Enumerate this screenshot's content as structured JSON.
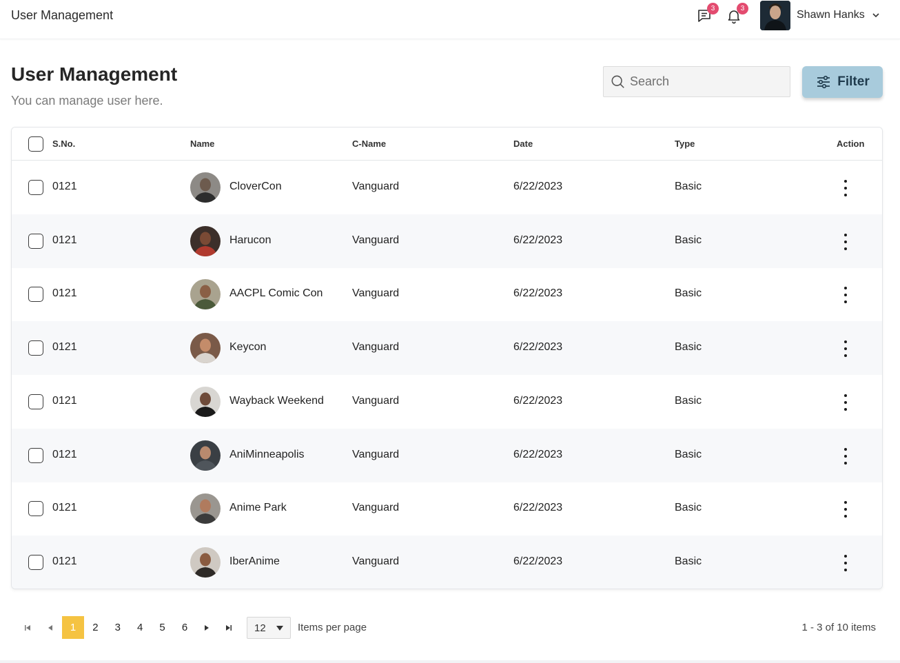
{
  "header": {
    "app_title": "User Management",
    "messages_badge": "3",
    "notifications_badge": "3",
    "user_name": "Shawn Hanks"
  },
  "page": {
    "title": "User Management",
    "subtitle": "You can manage user here."
  },
  "search": {
    "placeholder": "Search"
  },
  "filter": {
    "label": "Filter"
  },
  "table": {
    "columns": [
      "S.No.",
      "Name",
      "C-Name",
      "Date",
      "Type",
      "Action"
    ],
    "rows": [
      {
        "sno": "0121",
        "name": "CloverCon",
        "cname": "Vanguard",
        "date": "6/22/2023",
        "type": "Basic"
      },
      {
        "sno": "0121",
        "name": "Harucon",
        "cname": "Vanguard",
        "date": "6/22/2023",
        "type": "Basic"
      },
      {
        "sno": "0121",
        "name": "AACPL Comic Con",
        "cname": "Vanguard",
        "date": "6/22/2023",
        "type": "Basic"
      },
      {
        "sno": "0121",
        "name": "Keycon",
        "cname": "Vanguard",
        "date": "6/22/2023",
        "type": "Basic"
      },
      {
        "sno": "0121",
        "name": "Wayback Weekend",
        "cname": "Vanguard",
        "date": "6/22/2023",
        "type": "Basic"
      },
      {
        "sno": "0121",
        "name": "AniMinneapolis",
        "cname": "Vanguard",
        "date": "6/22/2023",
        "type": "Basic"
      },
      {
        "sno": "0121",
        "name": "Anime Park",
        "cname": "Vanguard",
        "date": "6/22/2023",
        "type": "Basic"
      },
      {
        "sno": "0121",
        "name": "IberAnime",
        "cname": "Vanguard",
        "date": "6/22/2023",
        "type": "Basic"
      }
    ]
  },
  "pagination": {
    "pages": [
      "1",
      "2",
      "3",
      "4",
      "5",
      "6"
    ],
    "current": "1",
    "per_page": "12",
    "per_page_label": "Items per page",
    "range_text": "1 - 3 of 10 items"
  },
  "colors": {
    "accent_page": "#f5c342",
    "filter_button": "#a8cbdc",
    "badge": "#e34b6f"
  },
  "icons": {
    "messages": "message-icon",
    "notifications": "bell-icon",
    "search": "search-icon",
    "filter": "sliders-icon",
    "row_action": "kebab-menu-icon"
  }
}
